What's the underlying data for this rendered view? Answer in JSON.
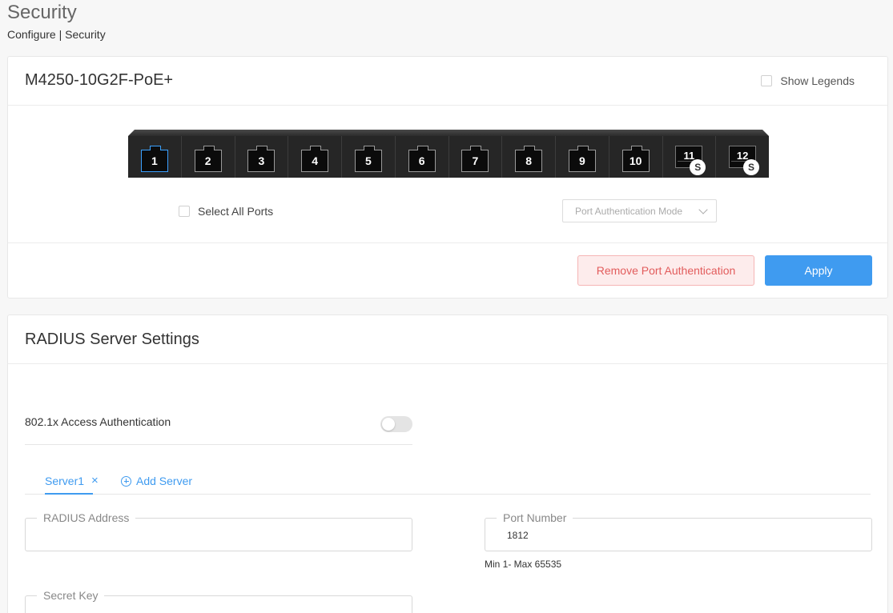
{
  "page": {
    "title": "Security",
    "breadcrumb": "Configure | Security"
  },
  "device_card": {
    "title": "M4250-10G2F-PoE+",
    "show_legends_label": "Show Legends",
    "select_all_label": "Select All Ports",
    "mode_dropdown_placeholder": "Port Authentication Mode",
    "remove_button_label": "Remove Port Authentication",
    "apply_button_label": "Apply",
    "ports": [
      {
        "label": "1",
        "type": "rj45",
        "selected": true
      },
      {
        "label": "2",
        "type": "rj45"
      },
      {
        "label": "3",
        "type": "rj45"
      },
      {
        "label": "4",
        "type": "rj45"
      },
      {
        "label": "5",
        "type": "rj45"
      },
      {
        "label": "6",
        "type": "rj45"
      },
      {
        "label": "7",
        "type": "rj45"
      },
      {
        "label": "8",
        "type": "rj45"
      },
      {
        "label": "9",
        "type": "rj45"
      },
      {
        "label": "10",
        "type": "rj45"
      },
      {
        "label": "11",
        "type": "sfp",
        "badge": "S"
      },
      {
        "label": "12",
        "type": "sfp",
        "badge": "S"
      }
    ]
  },
  "radius_card": {
    "title": "RADIUS Server Settings",
    "auth_label": "802.1x Access Authentication",
    "tabs": {
      "active_label": "Server1",
      "close_glyph": "×",
      "add_label": "Add Server"
    },
    "fields": {
      "radius_address_label": "RADIUS Address",
      "radius_address_value": "",
      "port_number_label": "Port Number",
      "port_number_value": "1812",
      "port_hint": "Min 1- Max 65535",
      "secret_key_label": "Secret Key"
    }
  },
  "colors": {
    "accent": "#3f9bf0",
    "danger_text": "#e25c5c",
    "danger_bg": "#fdecec"
  }
}
